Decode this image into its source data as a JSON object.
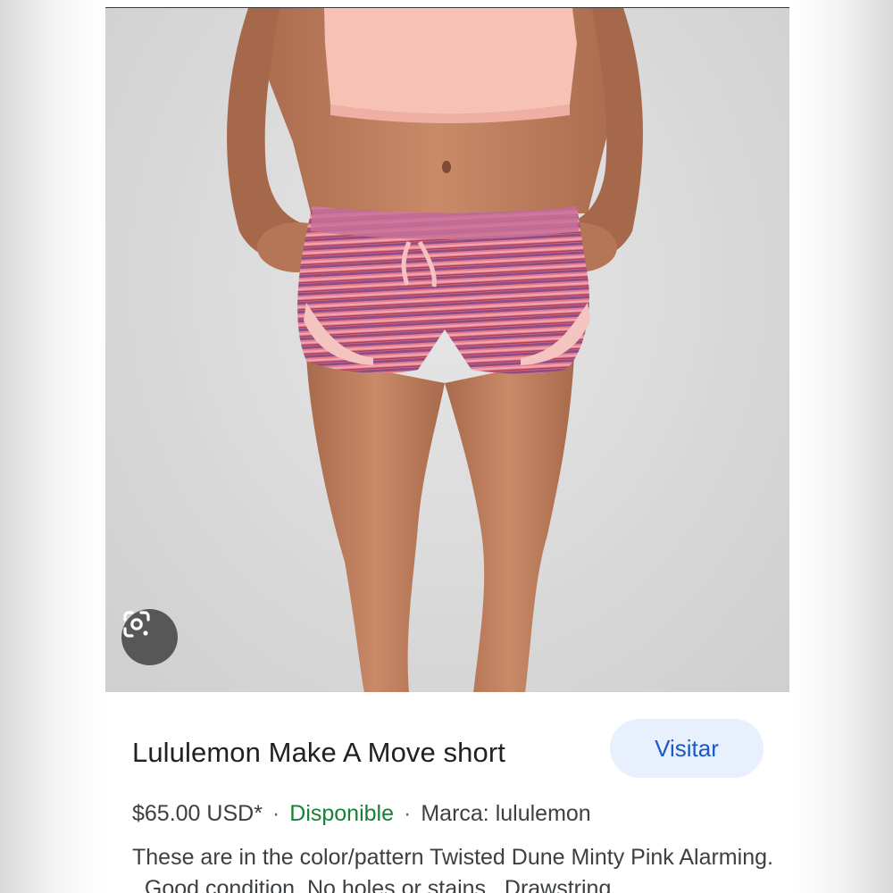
{
  "product": {
    "title": "Lululemon Make A Move short",
    "visit_label": "Visitar",
    "price": "$65.00 USD*",
    "separator": "·",
    "availability": "Disponible",
    "brand": "Marca: lululemon",
    "description": "These are in the color/pattern Twisted Dune Minty Pink Alarming. , Good condition. No holes or stains., Drawstring"
  },
  "icons": {
    "lens": "google-lens-icon"
  },
  "colors": {
    "visit_bg": "#e8f0fe",
    "visit_text": "#1a58c7",
    "availability": "#188038",
    "title": "#202124"
  }
}
